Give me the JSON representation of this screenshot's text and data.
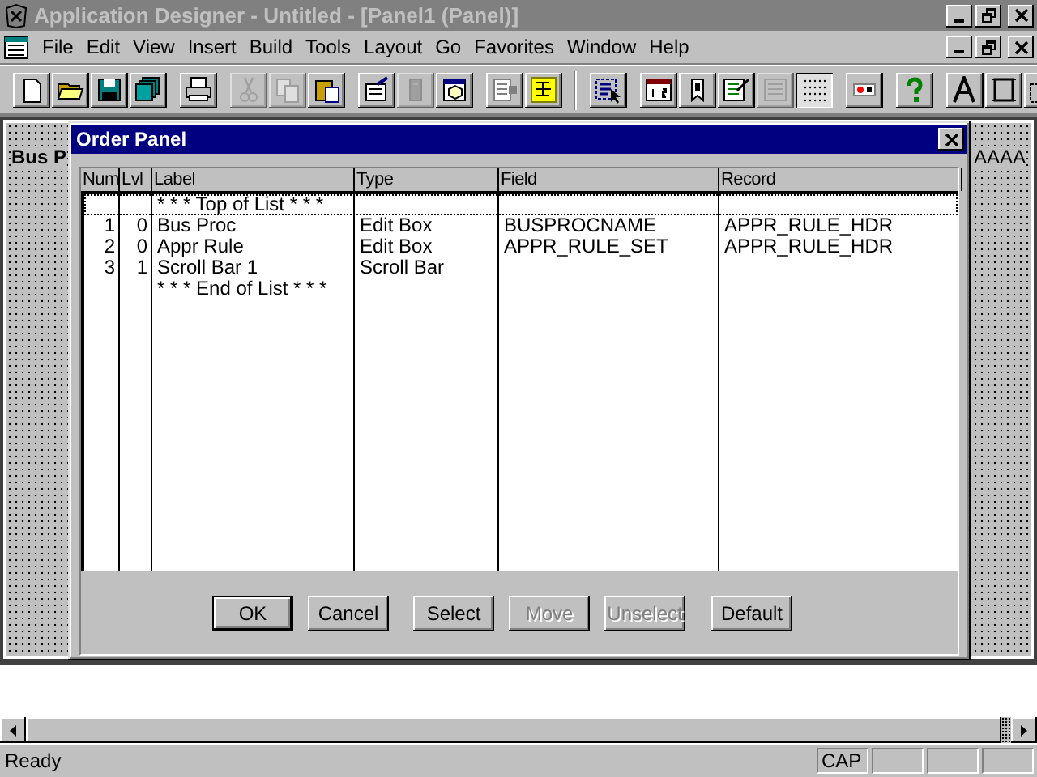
{
  "window": {
    "title": "Application Designer - Untitled - [Panel1 (Panel)]"
  },
  "menu": [
    "File",
    "Edit",
    "View",
    "Insert",
    "Build",
    "Tools",
    "Layout",
    "Go",
    "Favorites",
    "Window",
    "Help"
  ],
  "toolbar": [
    {
      "disabled": false,
      "pressed": false
    },
    {
      "disabled": false,
      "pressed": false
    },
    {
      "disabled": false,
      "pressed": false
    },
    {
      "disabled": false,
      "pressed": false
    },
    {
      "disabled": false,
      "pressed": false
    },
    {
      "disabled": true,
      "pressed": false
    },
    {
      "disabled": true,
      "pressed": false
    },
    {
      "disabled": false,
      "pressed": false
    },
    {
      "disabled": false,
      "pressed": false
    },
    {
      "disabled": true,
      "pressed": false
    },
    {
      "disabled": false,
      "pressed": false
    },
    {
      "disabled": false,
      "pressed": false
    },
    {
      "disabled": false,
      "pressed": false
    },
    {
      "disabled": false,
      "pressed": false
    },
    {
      "disabled": false,
      "pressed": false
    },
    {
      "disabled": false,
      "pressed": false
    },
    {
      "disabled": false,
      "pressed": false
    },
    {
      "disabled": true,
      "pressed": false
    },
    {
      "disabled": false,
      "pressed": true
    },
    {
      "disabled": false,
      "pressed": false
    },
    {
      "disabled": false,
      "pressed": false
    },
    {
      "disabled": false,
      "pressed": false
    },
    {
      "disabled": false,
      "pressed": false
    },
    {
      "disabled": false,
      "pressed": false
    }
  ],
  "panel": {
    "label": "Bus P",
    "text_right": "AAAA"
  },
  "dialog": {
    "title": "Order Panel",
    "columns": [
      "Num",
      "Lvl",
      "Label",
      "Type",
      "Field",
      "Record"
    ],
    "rows": [
      {
        "label": "* * * Top of List * * *",
        "focused": true
      },
      {
        "num": "1",
        "lvl": "0",
        "label": "Bus Proc",
        "type": "Edit Box",
        "field": "BUSPROCNAME",
        "record": "APPR_RULE_HDR",
        "focused": false
      },
      {
        "num": "2",
        "lvl": "0",
        "label": "Appr Rule",
        "type": "Edit Box",
        "field": "APPR_RULE_SET",
        "record": "APPR_RULE_HDR",
        "focused": false
      },
      {
        "num": "3",
        "lvl": "1",
        "label": "Scroll Bar 1",
        "type": "Scroll Bar",
        "focused": false
      },
      {
        "label": "* * * End of List * * *",
        "focused": false
      }
    ],
    "buttons": [
      {
        "label": "OK",
        "disabled": false,
        "default": true
      },
      {
        "label": "Cancel",
        "disabled": false,
        "default": false
      },
      {
        "label": "Select",
        "disabled": false,
        "default": false
      },
      {
        "label": "Move",
        "disabled": true,
        "default": false
      },
      {
        "label": "Unselect",
        "disabled": true,
        "default": false
      },
      {
        "label": "Default",
        "disabled": false,
        "default": false
      }
    ]
  },
  "status_bar": {
    "text": "Ready",
    "indicators": [
      "CAP"
    ]
  }
}
